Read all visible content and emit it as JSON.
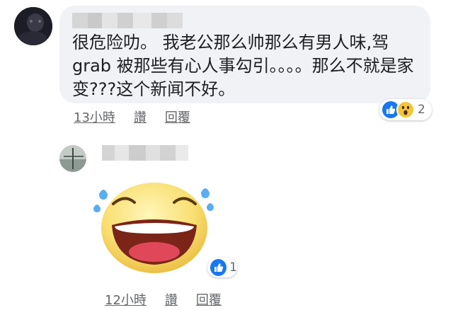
{
  "comment1": {
    "text": "很危险叻。 我老公那么帅那么有男人味,驾grab 被那些有心人事勾引。。。。那么不就是家变???这个新闻不好。",
    "reaction_count": "2",
    "time": "13小時",
    "like_label": "讚",
    "reply_label": "回覆"
  },
  "comment2": {
    "reaction_count": "1",
    "time": "12小時",
    "like_label": "讚",
    "reply_label": "回覆"
  },
  "colors": {
    "like_blue": "#1877f2",
    "bubble_bg": "#f0f2f5",
    "meta_gray": "#65676b"
  },
  "icons": {
    "like": "thumbs-up-icon",
    "wow": "wow-face-icon",
    "sticker": "laughing-face-sticker"
  }
}
